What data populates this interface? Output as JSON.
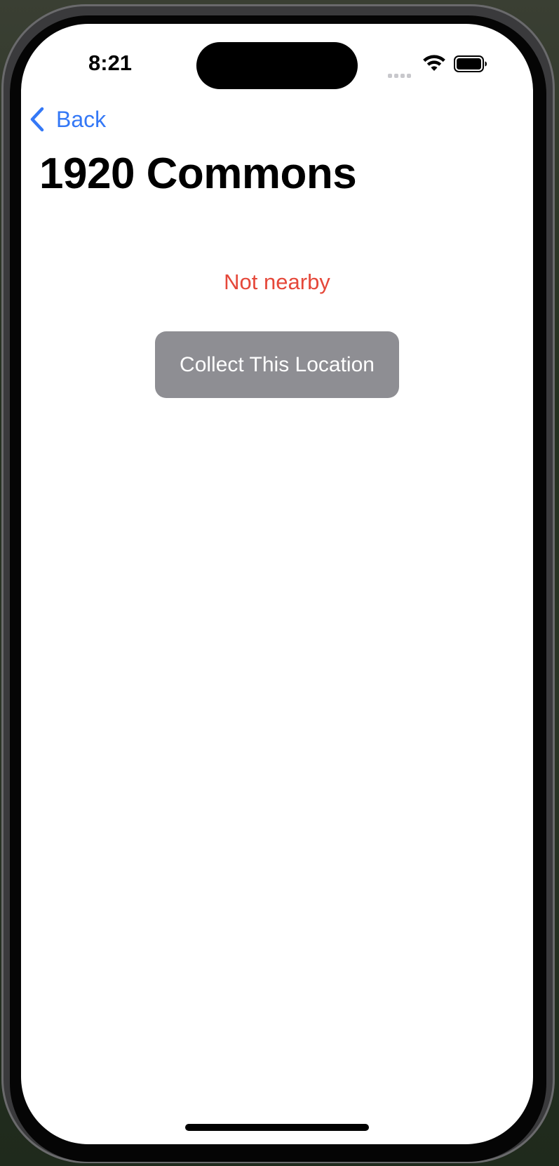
{
  "status_bar": {
    "time": "8:21",
    "wifi_icon": "wifi-icon",
    "battery_icon": "battery-icon",
    "signal_icon": "cellular-signal-dots-icon"
  },
  "navigation": {
    "back_label": "Back",
    "back_icon": "chevron-left-icon",
    "accent_color": "#3478f6"
  },
  "location": {
    "title": "1920 Commons",
    "status": "Not nearby",
    "status_color": "#e5483a"
  },
  "actions": {
    "collect_label": "Collect This Location",
    "collect_enabled": false,
    "collect_color": "#8e8e93"
  }
}
